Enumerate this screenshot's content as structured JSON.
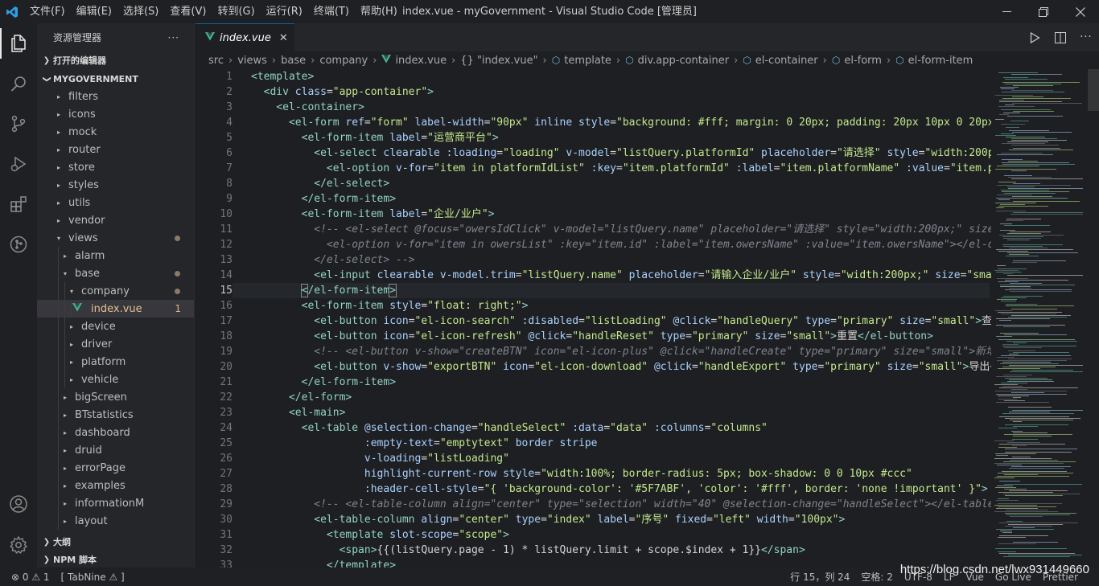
{
  "window": {
    "title": "index.vue - myGovernment - Visual Studio Code [管理员]",
    "menu": [
      "文件(F)",
      "编辑(E)",
      "选择(S)",
      "查看(V)",
      "转到(G)",
      "运行(R)",
      "终端(T)",
      "帮助(H)"
    ]
  },
  "sidebar": {
    "title": "资源管理器",
    "more": "···",
    "open_editors": "打开的编辑器",
    "project": "MYGOVERNMENT",
    "outline": "大纲",
    "npm": "NPM 脚本",
    "tree": [
      {
        "label": "filters",
        "depth": 0,
        "arrow": "▸"
      },
      {
        "label": "icons",
        "depth": 0,
        "arrow": "▸"
      },
      {
        "label": "mock",
        "depth": 0,
        "arrow": "▸"
      },
      {
        "label": "router",
        "depth": 0,
        "arrow": "▸"
      },
      {
        "label": "store",
        "depth": 0,
        "arrow": "▸"
      },
      {
        "label": "styles",
        "depth": 0,
        "arrow": "▸"
      },
      {
        "label": "utils",
        "depth": 0,
        "arrow": "▸"
      },
      {
        "label": "vendor",
        "depth": 0,
        "arrow": "▸"
      },
      {
        "label": "views",
        "depth": 0,
        "arrow": "▾"
      },
      {
        "label": "alarm",
        "depth": 1,
        "arrow": "▸"
      },
      {
        "label": "base",
        "depth": 1,
        "arrow": "▾"
      },
      {
        "label": "company",
        "depth": 2,
        "arrow": "▾"
      },
      {
        "label": "index.vue",
        "depth": 3,
        "arrow": "",
        "count": "1"
      },
      {
        "label": "device",
        "depth": 2,
        "arrow": "▸"
      },
      {
        "label": "driver",
        "depth": 2,
        "arrow": "▸"
      },
      {
        "label": "platform",
        "depth": 2,
        "arrow": "▸"
      },
      {
        "label": "vehicle",
        "depth": 2,
        "arrow": "▸"
      },
      {
        "label": "bigScreen",
        "depth": 1,
        "arrow": "▸"
      },
      {
        "label": "BTstatistics",
        "depth": 1,
        "arrow": "▸"
      },
      {
        "label": "dashboard",
        "depth": 1,
        "arrow": "▸"
      },
      {
        "label": "druid",
        "depth": 1,
        "arrow": "▸"
      },
      {
        "label": "errorPage",
        "depth": 1,
        "arrow": "▸"
      },
      {
        "label": "examples",
        "depth": 1,
        "arrow": "▸"
      },
      {
        "label": "informationM",
        "depth": 1,
        "arrow": "▸"
      },
      {
        "label": "layout",
        "depth": 1,
        "arrow": "▸"
      }
    ]
  },
  "tab": {
    "name": "index.vue",
    "close": "✕"
  },
  "breadcrumb": [
    "src",
    "views",
    "base",
    "company",
    "index.vue",
    "{} \"index.vue\"",
    "template",
    "div.app-container",
    "el-container",
    "el-form",
    "el-form-item"
  ],
  "editor": {
    "line_numbers": [
      "1",
      "2",
      "3",
      "4",
      "5",
      "6",
      "7",
      "8",
      "9",
      "10",
      "11",
      "12",
      "13",
      "14",
      "15",
      "16",
      "17",
      "18",
      "19",
      "20",
      "21",
      "22",
      "23",
      "24",
      "25",
      "26",
      "27",
      "28",
      "29",
      "30",
      "31",
      "32",
      "33"
    ],
    "current_line": 15
  },
  "status": {
    "problems": "⊗ 0 ⚠ 1",
    "tabnine": "[ TabNine ⚠ ]",
    "position": "行 15，列 24",
    "spaces": "空格: 2",
    "encoding": "UTF-8",
    "eol": "LF",
    "language": "Vue",
    "golive": "Go Live",
    "prettier": "Prettier"
  },
  "watermark": "https://blog.csdn.net/lwx931449660"
}
